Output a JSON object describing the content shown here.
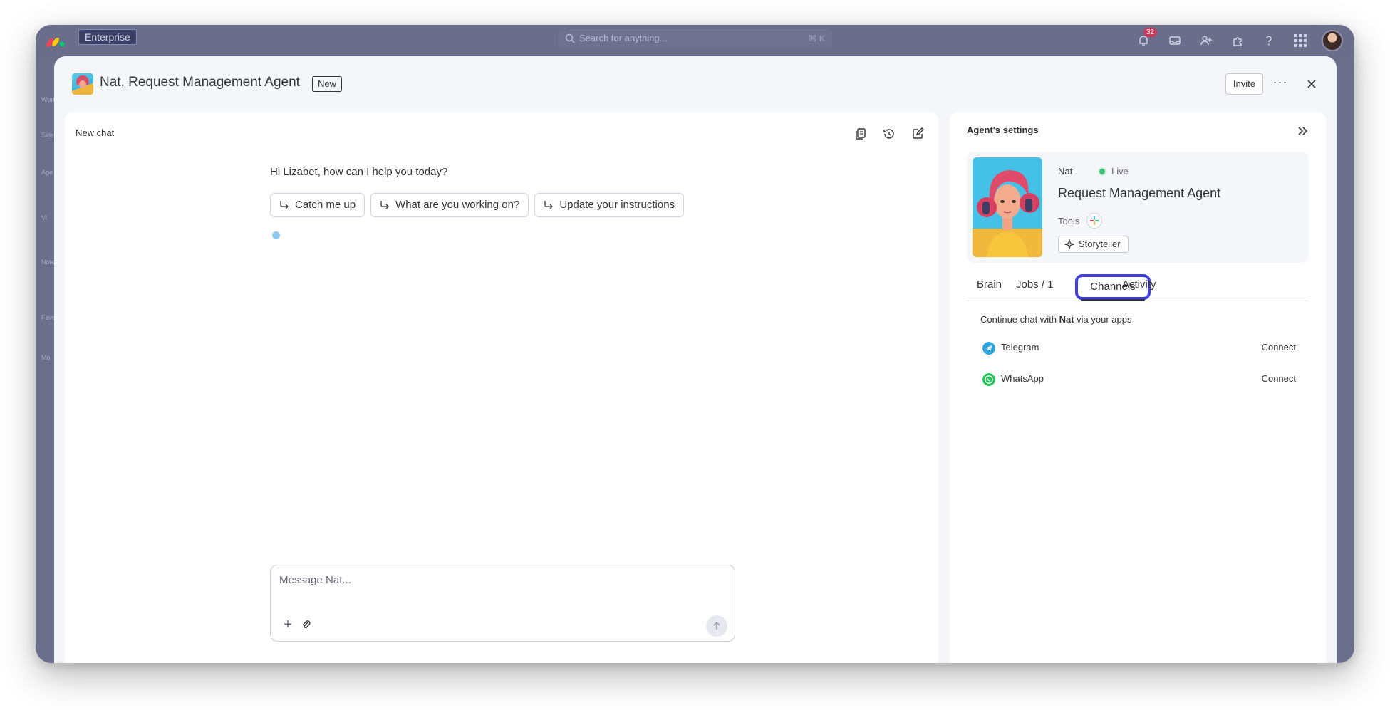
{
  "topbar": {
    "plan_badge": "Enterprise",
    "search_placeholder": "Search for anything...",
    "notification_count": "32"
  },
  "side_rail": {
    "items": [
      "Works",
      "Side",
      "Age",
      "Vi",
      "Notet",
      "Favo",
      "Mo"
    ]
  },
  "modal": {
    "title": "Nat, Request Management Agent",
    "badge": "New",
    "invite_label": "Invite",
    "more_label": "···"
  },
  "chat": {
    "title": "New chat",
    "greeting": "Hi Lizabet, how can I help you today?",
    "suggestions": [
      {
        "label": "Catch me up"
      },
      {
        "label": "What are you working on?"
      },
      {
        "label": "Update your instructions"
      }
    ],
    "composer_placeholder": "Message Nat..."
  },
  "settings": {
    "title": "Agent's settings",
    "agent": {
      "short_name": "Nat",
      "status": "Live",
      "role": "Request Management Agent",
      "tools_label": "Tools",
      "skill_chip": "Storyteller"
    },
    "tabs": [
      {
        "label": "Brain"
      },
      {
        "label": "Jobs / 1"
      },
      {
        "label": "Channels",
        "active": true
      },
      {
        "label": "Activity"
      }
    ],
    "channels": {
      "intro_before": "Continue chat with ",
      "intro_name": "Nat",
      "intro_after": " via your apps",
      "items": [
        {
          "name": "Telegram",
          "action": "Connect",
          "icon": "telegram-icon",
          "color": "#2aa3df"
        },
        {
          "name": "WhatsApp",
          "action": "Connect",
          "icon": "whatsapp-icon",
          "color": "#25c35a"
        }
      ]
    }
  },
  "colors": {
    "accent": "#3f3ee0",
    "live": "#3cc374",
    "topbar": "#6a6e8b"
  }
}
